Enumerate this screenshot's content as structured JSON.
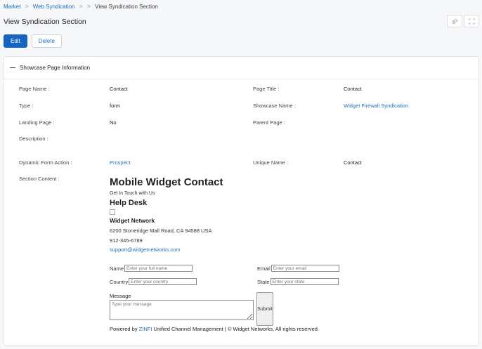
{
  "breadcrumb": {
    "item1": "Market",
    "item2": "Web Syndication",
    "current": "View Syndication Section"
  },
  "page_title": "View Syndication Section",
  "top_icons": [
    "pin-icon",
    "fullscreen-icon"
  ],
  "actions": {
    "edit": "Edit",
    "delete": "Delete"
  },
  "panel": {
    "title": "Showcase Page Information",
    "page_name_label": "Page Name :",
    "page_name": "Contact",
    "page_title_label": "Page Title :",
    "page_title": "Contact",
    "type_label": "Type :",
    "type": "form",
    "showcase_name_label": "Showcase Name :",
    "showcase_name": "Widget Firewall Syndication",
    "landing_page_label": "Landing Page :",
    "landing_page": "No",
    "parent_page_label": "Parent Page :",
    "description_label": "Description :",
    "dynamic_form_label": "Dynamic Form Action :",
    "dynamic_form": "Prospect",
    "unique_name_label": "Unique Name :",
    "unique_name": "Contact",
    "section_content_label": "Section Content :"
  },
  "section": {
    "heading": "Mobile Widget Contact",
    "get_in_touch": "Get In Touch with Us",
    "help_desk": "Help Desk",
    "company": "Widget Network",
    "address": "6200 Stoneridge Mall Road, CA 94588 USA",
    "phone": "912-345-6789",
    "email": "support@widgetnetworks.com",
    "form": {
      "name_label": "Name",
      "name_placeholder": "Enter your full name",
      "email_label": "Email",
      "email_placeholder": "Enter your email",
      "country_label": "Country",
      "country_placeholder": "Enter your country",
      "state_label": "State",
      "state_placeholder": "Enter your state",
      "message_label": "Message",
      "message_placeholder": "Type your message",
      "submit": "Submit"
    },
    "footer_prefix": "Powered by ",
    "footer_brand": "ZINFI",
    "footer_suffix": " Unified Channel Management | © Widget Networks, All rights reserved."
  },
  "colors": {
    "primary": "#1565c0",
    "link": "#1f6fb8"
  }
}
